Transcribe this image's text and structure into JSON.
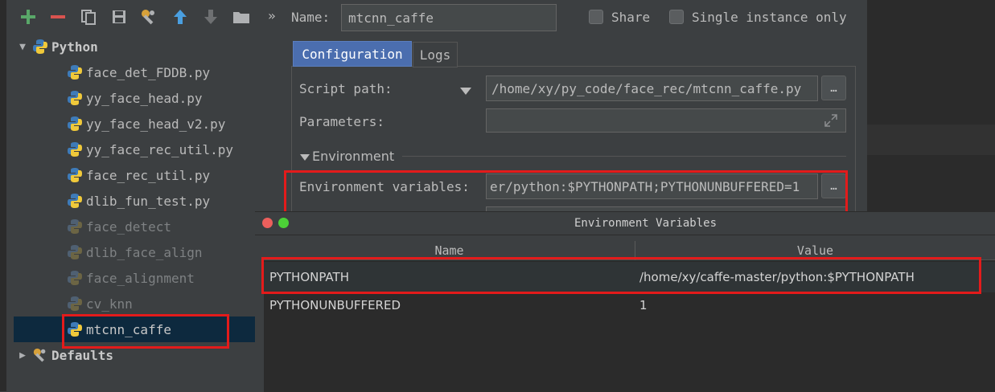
{
  "toolbar": {
    "add_icon": "plus-icon",
    "remove_icon": "minus-icon",
    "copy_icon": "copy-icon",
    "save_icon": "save-icon",
    "wrench_icon": "wrench-icon",
    "up_icon": "arrow-up-icon",
    "down_icon": "arrow-down-icon",
    "folder_icon": "folder-icon",
    "more": "»"
  },
  "name_field": {
    "label": "Name:",
    "value": "mtcnn_caffe"
  },
  "share": {
    "label": "Share",
    "checked": false
  },
  "single_instance": {
    "label": "Single instance only",
    "checked": false
  },
  "tree": {
    "root": "Python",
    "items": [
      {
        "label": "face_det_FDDB.py",
        "dim": false
      },
      {
        "label": "yy_face_head.py",
        "dim": false
      },
      {
        "label": "yy_face_head_v2.py",
        "dim": false
      },
      {
        "label": "yy_face_rec_util.py",
        "dim": false
      },
      {
        "label": "face_rec_util.py",
        "dim": false
      },
      {
        "label": "dlib_fun_test.py",
        "dim": false
      },
      {
        "label": "face_detect",
        "dim": true
      },
      {
        "label": "dlib_face_align",
        "dim": true
      },
      {
        "label": "face_alignment",
        "dim": true
      },
      {
        "label": "cv_knn",
        "dim": true
      },
      {
        "label": "mtcnn_caffe",
        "dim": false,
        "selected": true
      }
    ],
    "defaults": "Defaults"
  },
  "tabs": [
    {
      "label": "Configuration",
      "active": true
    },
    {
      "label": "Logs",
      "active": false
    }
  ],
  "config": {
    "script_path_label": "Script path:",
    "script_path_value": "/home/xy/py_code/face_rec/mtcnn_caffe.py",
    "parameters_label": "Parameters:",
    "parameters_value": "",
    "environment_section": "Environment",
    "env_vars_label": "Environment variables:",
    "env_vars_value": "er/python:$PYTHONPATH;PYTHONUNBUFFERED=1",
    "browse_label": "…"
  },
  "dialog": {
    "title": "Environment Variables",
    "columns": [
      "Name",
      "Value"
    ],
    "rows": [
      {
        "name": "PYTHONPATH",
        "value": "/home/xy/caffe-master/python:$PYTHONPATH"
      },
      {
        "name": "PYTHONUNBUFFERED",
        "value": "1"
      }
    ]
  },
  "colors": {
    "highlight_box": "#e31b1b",
    "selection": "#0d293e",
    "background": "#3c3f41"
  }
}
